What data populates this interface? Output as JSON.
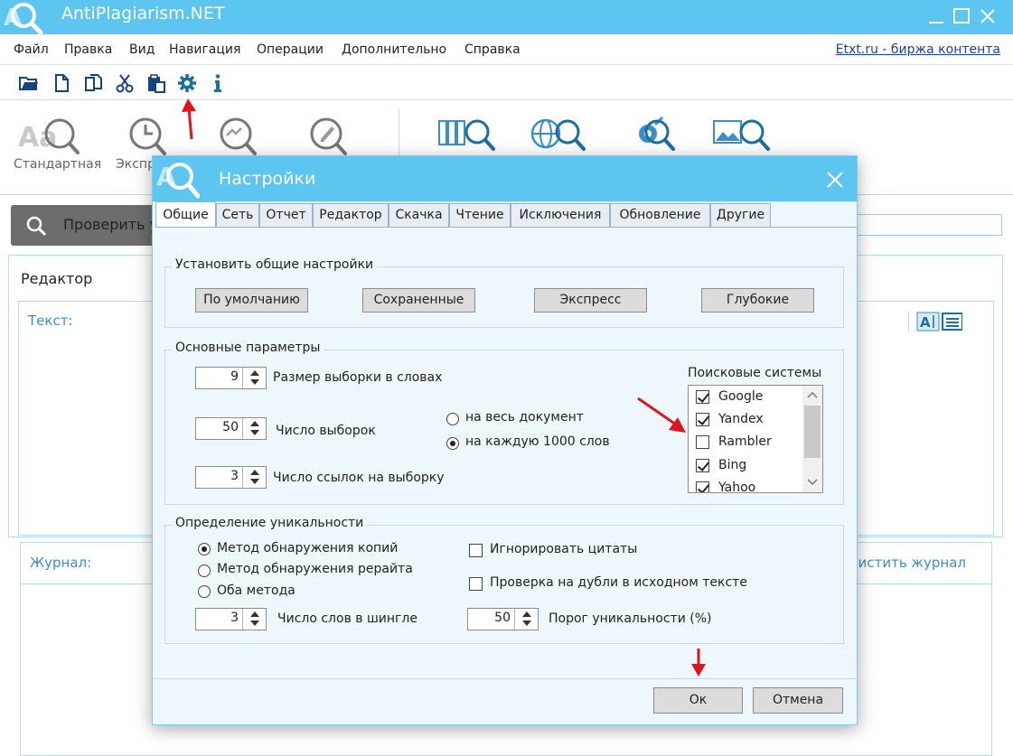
{
  "app": {
    "title": "AntiPlagiarism.NET",
    "logo_letter": "A"
  },
  "menu": {
    "items": [
      "Файл",
      "Правка",
      "Вид",
      "Навигация",
      "Операции",
      "Дополнительно",
      "Справка"
    ],
    "link": "Etxt.ru - биржа контента"
  },
  "toolbar": {
    "icons": [
      "open-folder-icon",
      "new-document-icon",
      "copy-icon",
      "cut-icon",
      "paste-icon",
      "settings-gear-icon",
      "info-icon"
    ]
  },
  "ribbon": {
    "items": [
      {
        "label": "Стандартная",
        "icon": "standard-check-icon"
      },
      {
        "label": "Экспр",
        "icon": "express-check-icon"
      },
      {
        "label": "",
        "icon": "deep-check-icon"
      },
      {
        "label": "",
        "icon": "rewrite-check-icon"
      },
      {
        "label": "",
        "icon": "library-search-icon"
      },
      {
        "label": "",
        "icon": "web-search-icon"
      },
      {
        "label": "",
        "icon": "seo-search-icon"
      },
      {
        "label": "",
        "icon": "image-search-icon"
      }
    ]
  },
  "main": {
    "check_button": "Проверить у",
    "editor_title": "Редактор",
    "text_label": "Текст:",
    "journal_label": "Журнал:",
    "journal_clear": "чистить журнал"
  },
  "dialog": {
    "title": "Настройки",
    "tabs": [
      "Общие",
      "Сеть",
      "Отчет",
      "Редактор",
      "Скачка",
      "Чтение",
      "Исключения",
      "Обновление",
      "Другие"
    ],
    "active_tab": "Общие",
    "presets": {
      "title": "Установить общие настройки",
      "buttons": [
        "По умолчанию",
        "Сохраненные",
        "Экспресс",
        "Глубокие"
      ]
    },
    "basic": {
      "title": "Основные параметры",
      "sample_size": {
        "value": "9",
        "label": "Размер выборки в словах"
      },
      "samples_count": {
        "value": "50",
        "label": "Число выборок"
      },
      "links_per_sample": {
        "value": "3",
        "label": "Число ссылок на выборку"
      },
      "scope_options": [
        {
          "label": "на весь документ",
          "selected": false
        },
        {
          "label": "на каждую 1000 слов",
          "selected": true
        }
      ],
      "search_engines_title": "Поисковые системы",
      "search_engines": [
        {
          "name": "Google",
          "checked": true
        },
        {
          "name": "Yandex",
          "checked": true
        },
        {
          "name": "Rambler",
          "checked": false
        },
        {
          "name": "Bing",
          "checked": true
        },
        {
          "name": "Yahoo",
          "checked": true
        }
      ]
    },
    "uniqueness": {
      "title": "Определение уникальности",
      "methods": [
        {
          "label": "Метод обнаружения копий",
          "selected": true
        },
        {
          "label": "Метод обнаружения рерайта",
          "selected": false
        },
        {
          "label": "Оба метода",
          "selected": false
        }
      ],
      "ignore_quotes": {
        "label": "Игнорировать цитаты",
        "checked": false
      },
      "check_duplicates": {
        "label": "Проверка на дубли в исходном тексте",
        "checked": false
      },
      "shingle_words": {
        "value": "3",
        "label": "Число слов в шингле"
      },
      "threshold": {
        "value": "50",
        "label": "Порог уникальности (%)"
      }
    },
    "ok_label": "Ок",
    "cancel_label": "Отмена"
  },
  "colors": {
    "accent": "#5cc6f0",
    "annotation_arrow": "#e0141e"
  }
}
